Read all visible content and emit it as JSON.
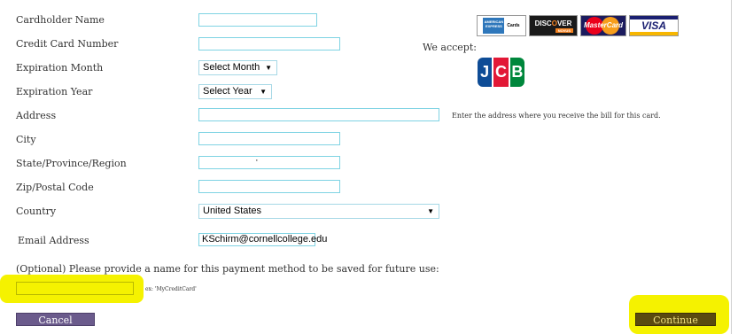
{
  "form": {
    "cardholder_name_label": "Cardholder Name",
    "card_number_label": "Credit Card Number",
    "exp_month_label": "Expiration Month",
    "exp_year_label": "Expiration Year",
    "address_label": "Address",
    "city_label": "City",
    "state_label": "State/Province/Region",
    "zip_label": "Zip/Postal Code",
    "country_label": "Country",
    "email_label": "Email Address",
    "cardholder_name_value": "",
    "card_number_value": "",
    "address_value": "",
    "city_value": "",
    "state_value": "·",
    "zip_value": "",
    "email_value": "KSchirm@cornellcollege.edu",
    "exp_month_selected": "Select Month",
    "exp_year_selected": "Select Year",
    "country_selected": "United States",
    "address_help": "Enter the address where you receive the bill for this card."
  },
  "payment": {
    "we_accept_label": "We accept:",
    "cards": [
      {
        "name": "American Express",
        "text": "AMERICAN EXPRESS Cards"
      },
      {
        "name": "Discover",
        "text": "DISCOVER",
        "sub": "NOVUS"
      },
      {
        "name": "MasterCard",
        "text": "MasterCard"
      },
      {
        "name": "Visa",
        "text": "VISA"
      },
      {
        "name": "JCB",
        "text": "JCB"
      }
    ]
  },
  "save_method": {
    "prompt": "(Optional) Please provide a name for this payment method to be saved for future use:",
    "name_value": "",
    "example_text": "ex: 'MyCreditCard'"
  },
  "buttons": {
    "cancel_label": "Cancel",
    "continue_label": "Continue"
  },
  "colors": {
    "button_purple": "#6b5b8c",
    "button_olive": "#5a4a10",
    "field_border": "#7fd3e3",
    "highlight": "#f5f200"
  }
}
